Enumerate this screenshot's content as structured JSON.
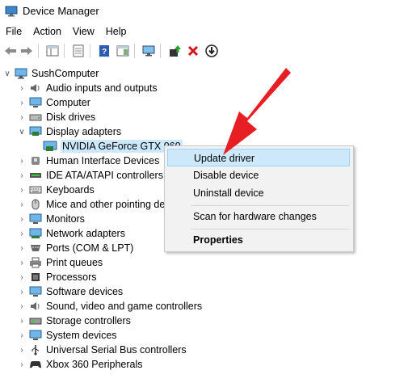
{
  "window": {
    "title": "Device Manager"
  },
  "menu": [
    "File",
    "Action",
    "View",
    "Help"
  ],
  "toolbar_icons": [
    "back-arrow-icon",
    "forward-arrow-icon",
    "properties-icon",
    "show-hide-console-tree-icon",
    "help-icon",
    "action-pane-icon",
    "monitor-icon",
    "update-driver-icon",
    "uninstall-icon",
    "disable-download-icon"
  ],
  "tree": {
    "root": "SushComputer",
    "items": [
      {
        "label": "Audio inputs and outputs",
        "icon": "speaker-icon",
        "expanded": false
      },
      {
        "label": "Computer",
        "icon": "computer-icon",
        "expanded": false
      },
      {
        "label": "Disk drives",
        "icon": "disk-drive-icon",
        "expanded": false
      },
      {
        "label": "Display adapters",
        "icon": "display-adapter-icon",
        "expanded": true
      },
      {
        "label": "NVIDIA GeForce GTX 960",
        "icon": "gpu-icon",
        "child": true,
        "selected": true
      },
      {
        "label": "Human Interface Devices",
        "icon": "hid-icon",
        "expanded": false
      },
      {
        "label": "IDE ATA/ATAPI controllers",
        "icon": "ide-controller-icon",
        "expanded": false
      },
      {
        "label": "Keyboards",
        "icon": "keyboard-icon",
        "expanded": false
      },
      {
        "label": "Mice and other pointing de",
        "icon": "mouse-icon",
        "expanded": false
      },
      {
        "label": "Monitors",
        "icon": "monitor-icon",
        "expanded": false
      },
      {
        "label": "Network adapters",
        "icon": "network-adapter-icon",
        "expanded": false
      },
      {
        "label": "Ports (COM & LPT)",
        "icon": "port-icon",
        "expanded": false
      },
      {
        "label": "Print queues",
        "icon": "printer-icon",
        "expanded": false
      },
      {
        "label": "Processors",
        "icon": "processor-icon",
        "expanded": false
      },
      {
        "label": "Software devices",
        "icon": "software-device-icon",
        "expanded": false
      },
      {
        "label": "Sound, video and game controllers",
        "icon": "sound-icon",
        "expanded": false
      },
      {
        "label": "Storage controllers",
        "icon": "storage-controller-icon",
        "expanded": false
      },
      {
        "label": "System devices",
        "icon": "system-device-icon",
        "expanded": false
      },
      {
        "label": "Universal Serial Bus controllers",
        "icon": "usb-icon",
        "expanded": false
      },
      {
        "label": "Xbox 360 Peripherals",
        "icon": "gamepad-icon",
        "expanded": false
      }
    ]
  },
  "context_menu": {
    "items": [
      {
        "label": "Update driver",
        "highlighted": true
      },
      {
        "label": "Disable device"
      },
      {
        "label": "Uninstall device"
      },
      {
        "label": "Scan for hardware changes"
      },
      {
        "label": "Properties",
        "bold": true
      }
    ]
  },
  "colors": {
    "selection": "#cce8ff",
    "menu_highlight": "#cde8fb",
    "arrow": "#e81e25"
  }
}
